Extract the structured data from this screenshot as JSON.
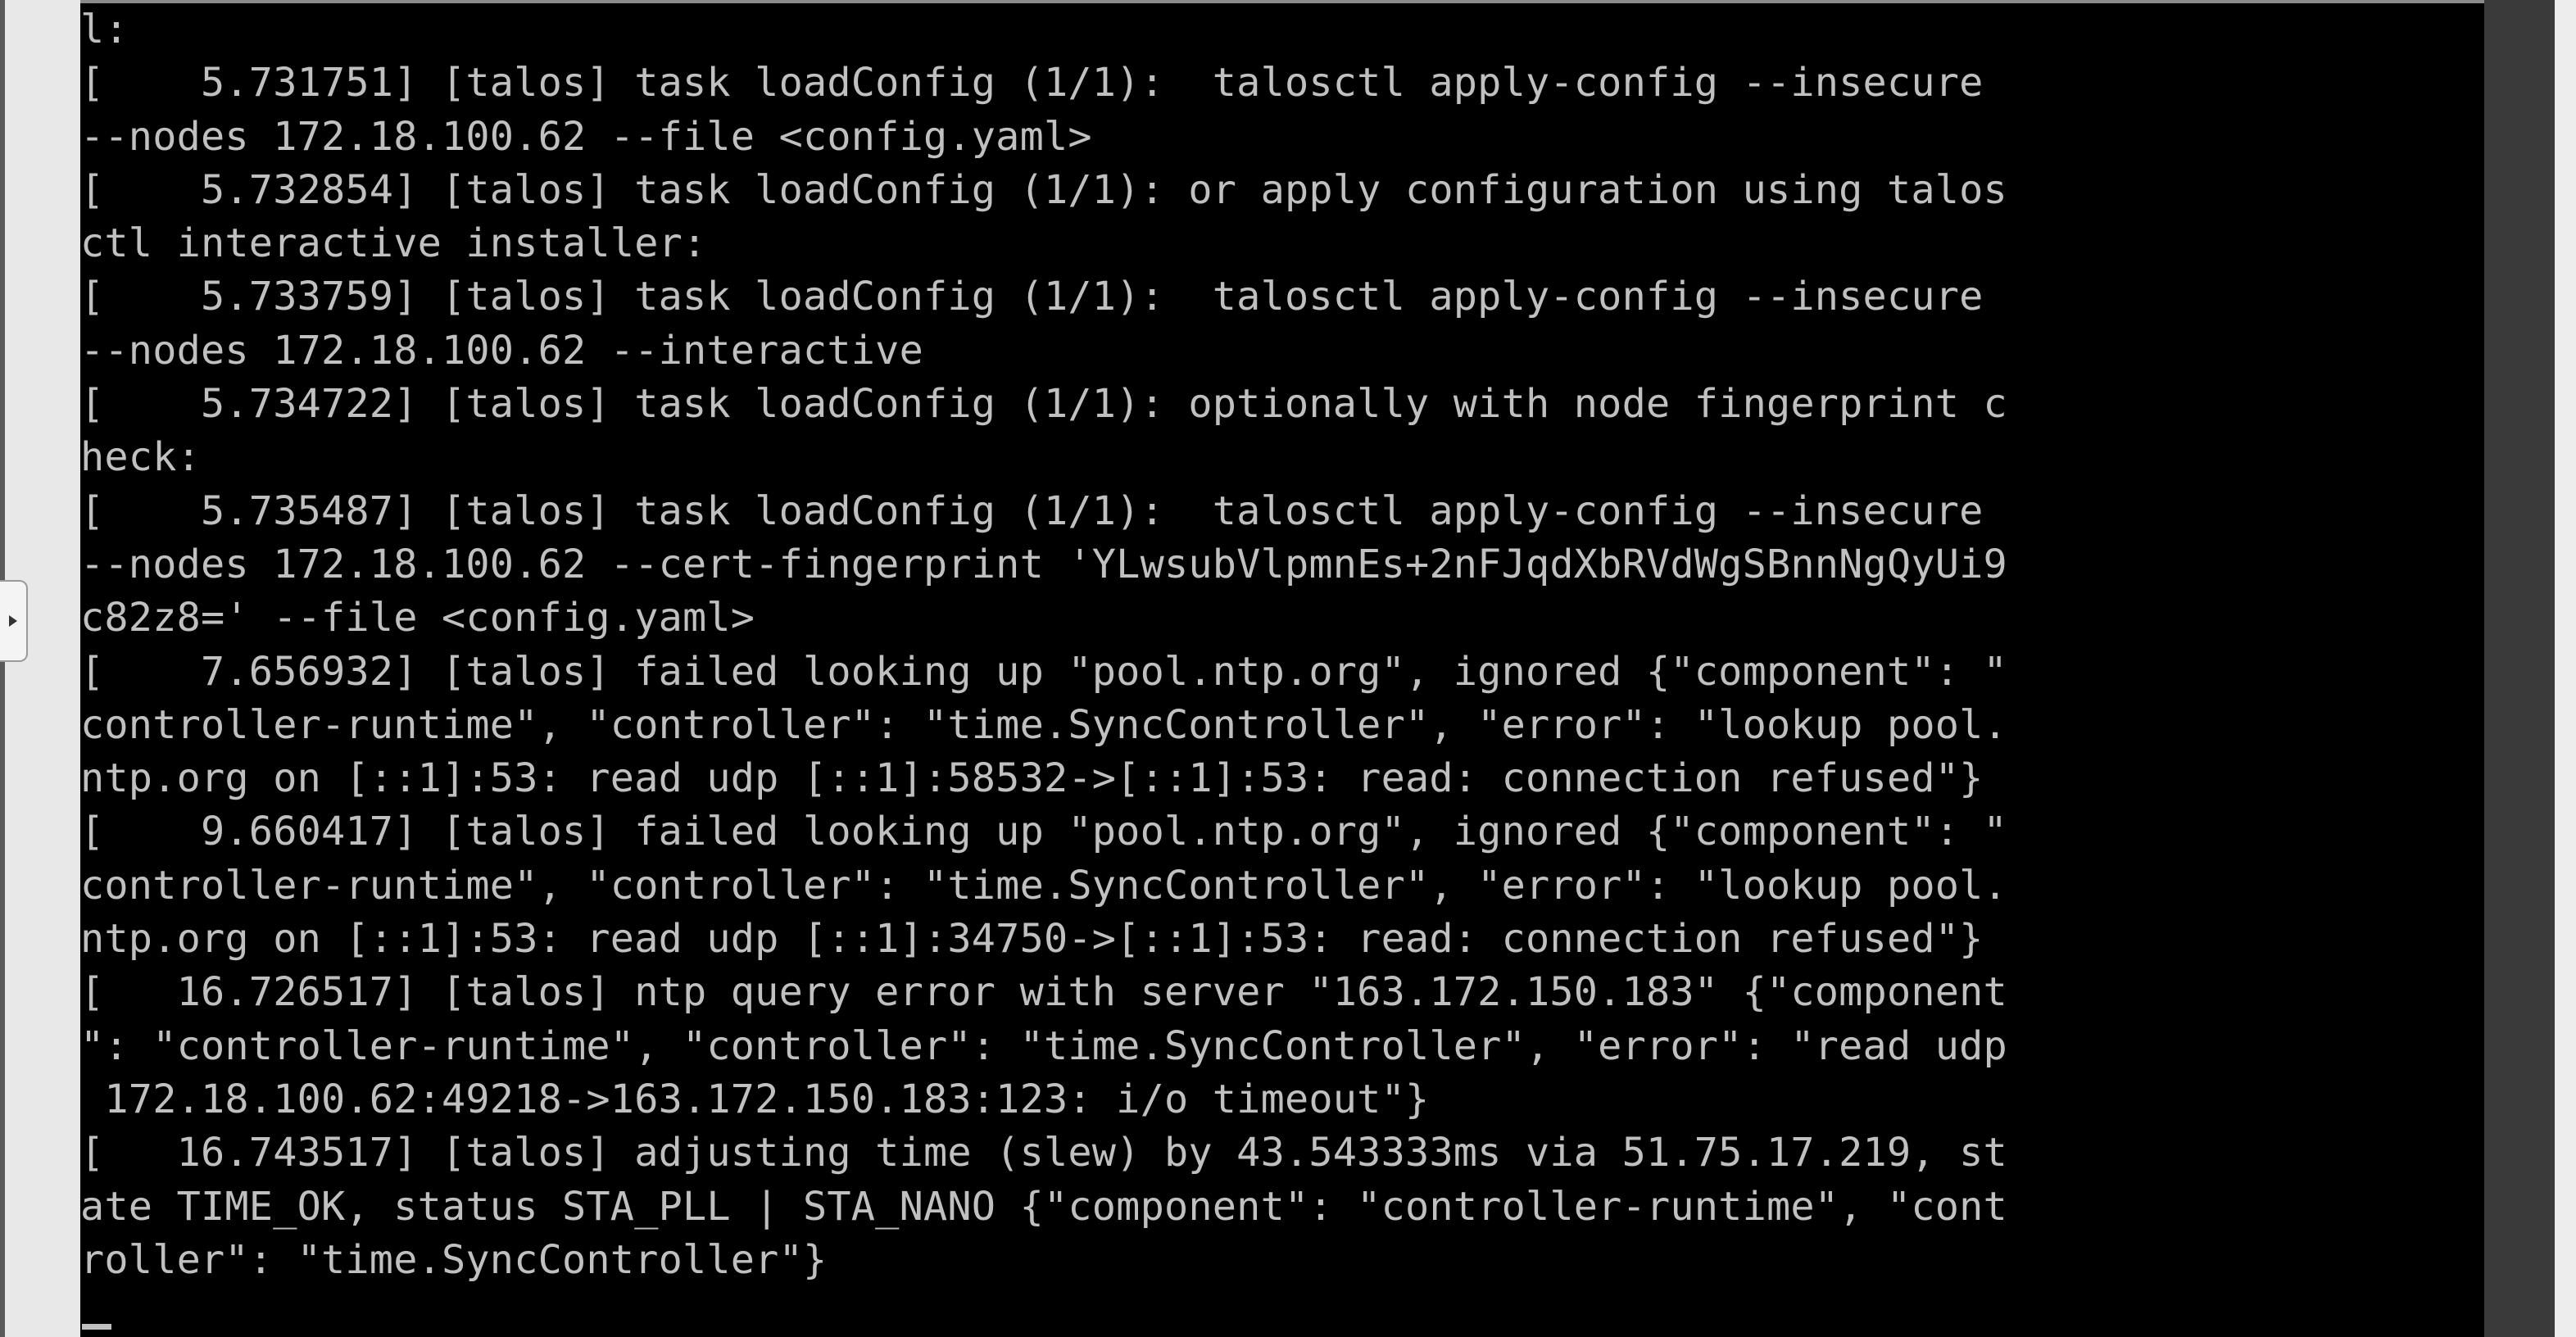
{
  "console": {
    "lines": [
      "l:",
      "[    5.731751] [talos] task loadConfig (1/1):  talosctl apply-config --insecure",
      "--nodes 172.18.100.62 --file <config.yaml>",
      "[    5.732854] [talos] task loadConfig (1/1): or apply configuration using talos",
      "ctl interactive installer:",
      "[    5.733759] [talos] task loadConfig (1/1):  talosctl apply-config --insecure",
      "--nodes 172.18.100.62 --interactive",
      "[    5.734722] [talos] task loadConfig (1/1): optionally with node fingerprint c",
      "heck:",
      "[    5.735487] [talos] task loadConfig (1/1):  talosctl apply-config --insecure",
      "--nodes 172.18.100.62 --cert-fingerprint 'YLwsubVlpmnEs+2nFJqdXbRVdWgSBnnNgQyUi9",
      "c82z8=' --file <config.yaml>",
      "[    7.656932] [talos] failed looking up \"pool.ntp.org\", ignored {\"component\": \"",
      "controller-runtime\", \"controller\": \"time.SyncController\", \"error\": \"lookup pool.",
      "ntp.org on [::1]:53: read udp [::1]:58532->[::1]:53: read: connection refused\"}",
      "[    9.660417] [talos] failed looking up \"pool.ntp.org\", ignored {\"component\": \"",
      "controller-runtime\", \"controller\": \"time.SyncController\", \"error\": \"lookup pool.",
      "ntp.org on [::1]:53: read udp [::1]:34750->[::1]:53: read: connection refused\"}",
      "[   16.726517] [talos] ntp query error with server \"163.172.150.183\" {\"component",
      "\": \"controller-runtime\", \"controller\": \"time.SyncController\", \"error\": \"read udp",
      " 172.18.100.62:49218->163.172.150.183:123: i/o timeout\"}",
      "[   16.743517] [talos] adjusting time (slew) by 43.543333ms via 51.75.17.219, st",
      "ate TIME_OK, status STA_PLL | STA_NANO {\"component\": \"controller-runtime\", \"cont",
      "roller\": \"time.SyncController\"}"
    ]
  },
  "colors": {
    "background": "#000000",
    "text": "#c0c0c0",
    "frame": "#e8e8e8",
    "right_panel": "#3a3a3a"
  },
  "icons": {
    "side_toggle": "chevron-right-icon"
  }
}
